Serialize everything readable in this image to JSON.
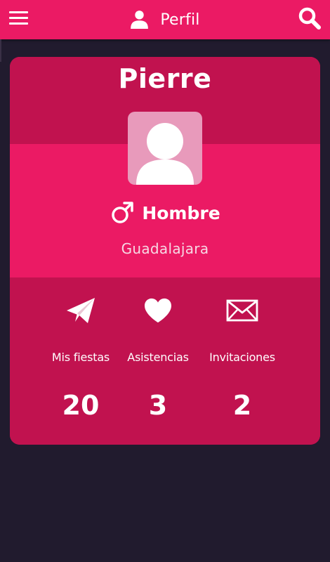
{
  "appbar": {
    "title": "Perfil",
    "menu_icon": "hamburger-menu-icon",
    "title_icon": "user-icon",
    "search_icon": "search-icon",
    "color": "#eb1a64"
  },
  "profile": {
    "name": "Pierre",
    "avatar_icon": "default-avatar-icon",
    "gender": "Hombre",
    "gender_icon": "male-symbol-icon",
    "city": "Guadalajara"
  },
  "stats": [
    {
      "label": "Mis fiestas",
      "value": "20",
      "icon": "paper-plane-icon"
    },
    {
      "label": "Asistencias",
      "value": "3",
      "icon": "heart-icon"
    },
    {
      "label": "Invitaciones",
      "value": "2",
      "icon": "envelope-icon"
    }
  ],
  "colors": {
    "accent": "#eb1a64",
    "accent_dark": "#c1124f",
    "background": "#211b2e"
  }
}
